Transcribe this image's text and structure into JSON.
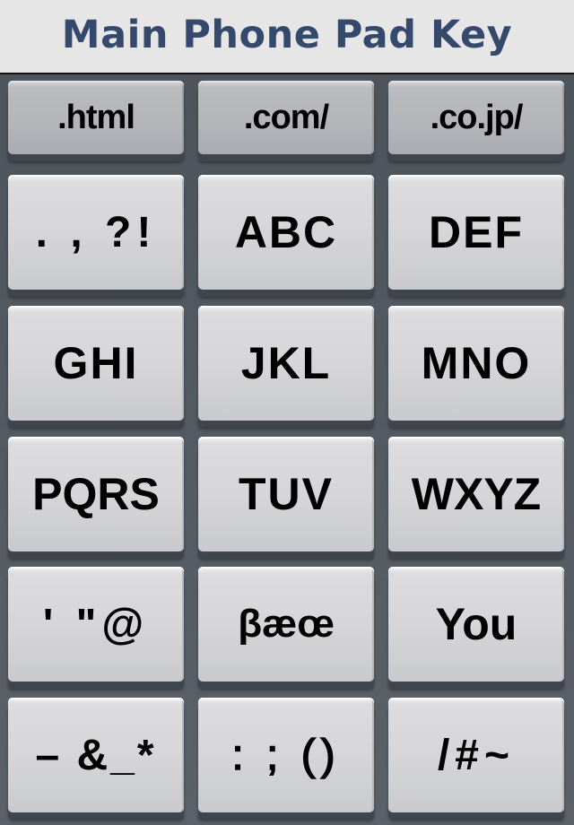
{
  "header": {
    "title": "Main Phone Pad Key"
  },
  "keypad": {
    "shortcut_keys": [
      {
        "label": ".html"
      },
      {
        "label": ".com/"
      },
      {
        "label": ".co.jp/"
      }
    ],
    "keys": [
      {
        "label": ". , ?!"
      },
      {
        "label": "ABC"
      },
      {
        "label": "DEF"
      },
      {
        "label": "GHI"
      },
      {
        "label": "JKL"
      },
      {
        "label": "MNO"
      },
      {
        "label": "PQRS"
      },
      {
        "label": "TUV"
      },
      {
        "label": "WXYZ"
      },
      {
        "label": "' \"@"
      },
      {
        "label": "βæœ"
      },
      {
        "label": "You"
      },
      {
        "label": "– &_*"
      },
      {
        "label": ": ; ()"
      },
      {
        "label": "/#~"
      }
    ]
  }
}
